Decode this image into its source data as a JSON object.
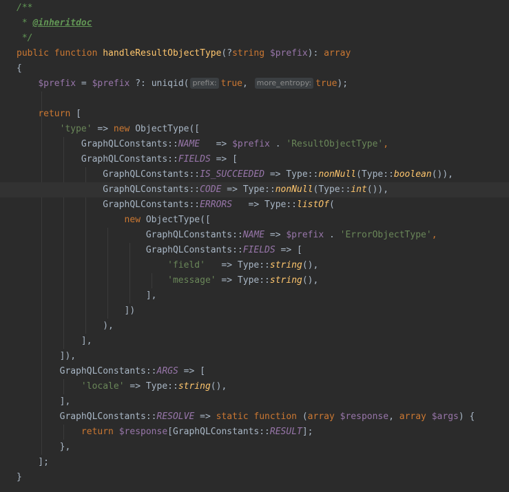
{
  "editor": {
    "lines": [
      [
        {
          "t": "/**",
          "c": "cm"
        }
      ],
      [
        {
          "t": " * ",
          "c": "cm"
        },
        {
          "t": "@inheritdoc",
          "c": "tag"
        }
      ],
      [
        {
          "t": " */",
          "c": "cm"
        }
      ],
      [
        {
          "t": "public function ",
          "c": "kw"
        },
        {
          "t": "handleResultObjectType",
          "c": "fn"
        },
        {
          "t": "(?",
          "c": "plain"
        },
        {
          "t": "string ",
          "c": "kw"
        },
        {
          "t": "$prefix",
          "c": "var"
        },
        {
          "t": "): ",
          "c": "plain"
        },
        {
          "t": "array",
          "c": "kw"
        }
      ],
      [
        {
          "t": "{",
          "c": "plain"
        }
      ],
      [
        {
          "t": "    ",
          "c": "plain"
        },
        {
          "t": "$prefix",
          "c": "var"
        },
        {
          "t": " = ",
          "c": "plain"
        },
        {
          "t": "$prefix",
          "c": "var"
        },
        {
          "t": " ?: uniqid(",
          "c": "plain"
        },
        {
          "t": "prefix:",
          "c": "hint"
        },
        {
          "t": "true",
          "c": "kw"
        },
        {
          "t": ", ",
          "c": "plain"
        },
        {
          "t": "more_entropy:",
          "c": "hint"
        },
        {
          "t": "true",
          "c": "kw"
        },
        {
          "t": ");",
          "c": "plain"
        }
      ],
      [],
      [
        {
          "t": "    ",
          "c": "plain"
        },
        {
          "t": "return ",
          "c": "kw"
        },
        {
          "t": "[",
          "c": "plain"
        }
      ],
      [
        {
          "t": "        ",
          "c": "plain"
        },
        {
          "t": "'type'",
          "c": "str"
        },
        {
          "t": " => ",
          "c": "plain"
        },
        {
          "t": "new ",
          "c": "kw"
        },
        {
          "t": "ObjectType([",
          "c": "plain"
        }
      ],
      [
        {
          "t": "            GraphQLConstants::",
          "c": "plain"
        },
        {
          "t": "NAME",
          "c": "const"
        },
        {
          "t": "   => ",
          "c": "plain"
        },
        {
          "t": "$prefix",
          "c": "var"
        },
        {
          "t": " . ",
          "c": "plain"
        },
        {
          "t": "'ResultObjectType'",
          "c": "str"
        },
        {
          "t": ",",
          "c": "kw"
        }
      ],
      [
        {
          "t": "            GraphQLConstants::",
          "c": "plain"
        },
        {
          "t": "FIELDS",
          "c": "const"
        },
        {
          "t": " => [",
          "c": "plain"
        }
      ],
      [
        {
          "t": "                GraphQLConstants::",
          "c": "plain"
        },
        {
          "t": "IS_SUCCEEDED",
          "c": "const"
        },
        {
          "t": " => Type::",
          "c": "plain"
        },
        {
          "t": "nonNull",
          "c": "sm"
        },
        {
          "t": "(Type::",
          "c": "plain"
        },
        {
          "t": "boolean",
          "c": "sm"
        },
        {
          "t": "()),",
          "c": "plain"
        }
      ],
      [
        {
          "t": "                GraphQLConstants::",
          "c": "plain"
        },
        {
          "t": "CODE",
          "c": "const"
        },
        {
          "t": " => Type::",
          "c": "plain"
        },
        {
          "t": "nonNull",
          "c": "sm"
        },
        {
          "t": "(Type::",
          "c": "plain"
        },
        {
          "t": "int",
          "c": "sm"
        },
        {
          "t": "()),",
          "c": "plain"
        }
      ],
      [
        {
          "t": "                GraphQLConstants::",
          "c": "plain"
        },
        {
          "t": "ERRORS",
          "c": "const"
        },
        {
          "t": "   => Type::",
          "c": "plain"
        },
        {
          "t": "listOf",
          "c": "sm"
        },
        {
          "t": "(",
          "c": "plain"
        }
      ],
      [
        {
          "t": "                    ",
          "c": "plain"
        },
        {
          "t": "new ",
          "c": "kw"
        },
        {
          "t": "ObjectType([",
          "c": "plain"
        }
      ],
      [
        {
          "t": "                        GraphQLConstants::",
          "c": "plain"
        },
        {
          "t": "NAME",
          "c": "const"
        },
        {
          "t": " => ",
          "c": "plain"
        },
        {
          "t": "$prefix",
          "c": "var"
        },
        {
          "t": " . ",
          "c": "plain"
        },
        {
          "t": "'ErrorObjectType'",
          "c": "str"
        },
        {
          "t": ",",
          "c": "kw"
        }
      ],
      [
        {
          "t": "                        GraphQLConstants::",
          "c": "plain"
        },
        {
          "t": "FIELDS",
          "c": "const"
        },
        {
          "t": " => [",
          "c": "plain"
        }
      ],
      [
        {
          "t": "                            ",
          "c": "plain"
        },
        {
          "t": "'field'",
          "c": "str"
        },
        {
          "t": "   => Type::",
          "c": "plain"
        },
        {
          "t": "string",
          "c": "sm"
        },
        {
          "t": "(),",
          "c": "plain"
        }
      ],
      [
        {
          "t": "                            ",
          "c": "plain"
        },
        {
          "t": "'message'",
          "c": "str"
        },
        {
          "t": " => Type::",
          "c": "plain"
        },
        {
          "t": "string",
          "c": "sm"
        },
        {
          "t": "(),",
          "c": "plain"
        }
      ],
      [
        {
          "t": "                        ],",
          "c": "plain"
        }
      ],
      [
        {
          "t": "                    ])",
          "c": "plain"
        }
      ],
      [
        {
          "t": "                ),",
          "c": "plain"
        }
      ],
      [
        {
          "t": "            ],",
          "c": "plain"
        }
      ],
      [
        {
          "t": "        ]),",
          "c": "plain"
        }
      ],
      [
        {
          "t": "        GraphQLConstants::",
          "c": "plain"
        },
        {
          "t": "ARGS",
          "c": "const"
        },
        {
          "t": " => [",
          "c": "plain"
        }
      ],
      [
        {
          "t": "            ",
          "c": "plain"
        },
        {
          "t": "'locale'",
          "c": "str"
        },
        {
          "t": " => Type::",
          "c": "plain"
        },
        {
          "t": "string",
          "c": "sm"
        },
        {
          "t": "(),",
          "c": "plain"
        }
      ],
      [
        {
          "t": "        ],",
          "c": "plain"
        }
      ],
      [
        {
          "t": "        GraphQLConstants::",
          "c": "plain"
        },
        {
          "t": "RESOLVE",
          "c": "const"
        },
        {
          "t": " => ",
          "c": "plain"
        },
        {
          "t": "static function ",
          "c": "kw"
        },
        {
          "t": "(",
          "c": "plain"
        },
        {
          "t": "array ",
          "c": "kw"
        },
        {
          "t": "$response",
          "c": "var"
        },
        {
          "t": ", ",
          "c": "plain"
        },
        {
          "t": "array ",
          "c": "kw"
        },
        {
          "t": "$args",
          "c": "var"
        },
        {
          "t": ") {",
          "c": "plain"
        }
      ],
      [
        {
          "t": "            ",
          "c": "plain"
        },
        {
          "t": "return ",
          "c": "kw"
        },
        {
          "t": "$response",
          "c": "var"
        },
        {
          "t": "[GraphQLConstants::",
          "c": "plain"
        },
        {
          "t": "RESULT",
          "c": "const"
        },
        {
          "t": "];",
          "c": "plain"
        }
      ],
      [
        {
          "t": "        },",
          "c": "plain"
        }
      ],
      [
        {
          "t": "    ];",
          "c": "plain"
        }
      ],
      [
        {
          "t": "}",
          "c": "plain"
        }
      ]
    ],
    "current_line_index": 12
  }
}
